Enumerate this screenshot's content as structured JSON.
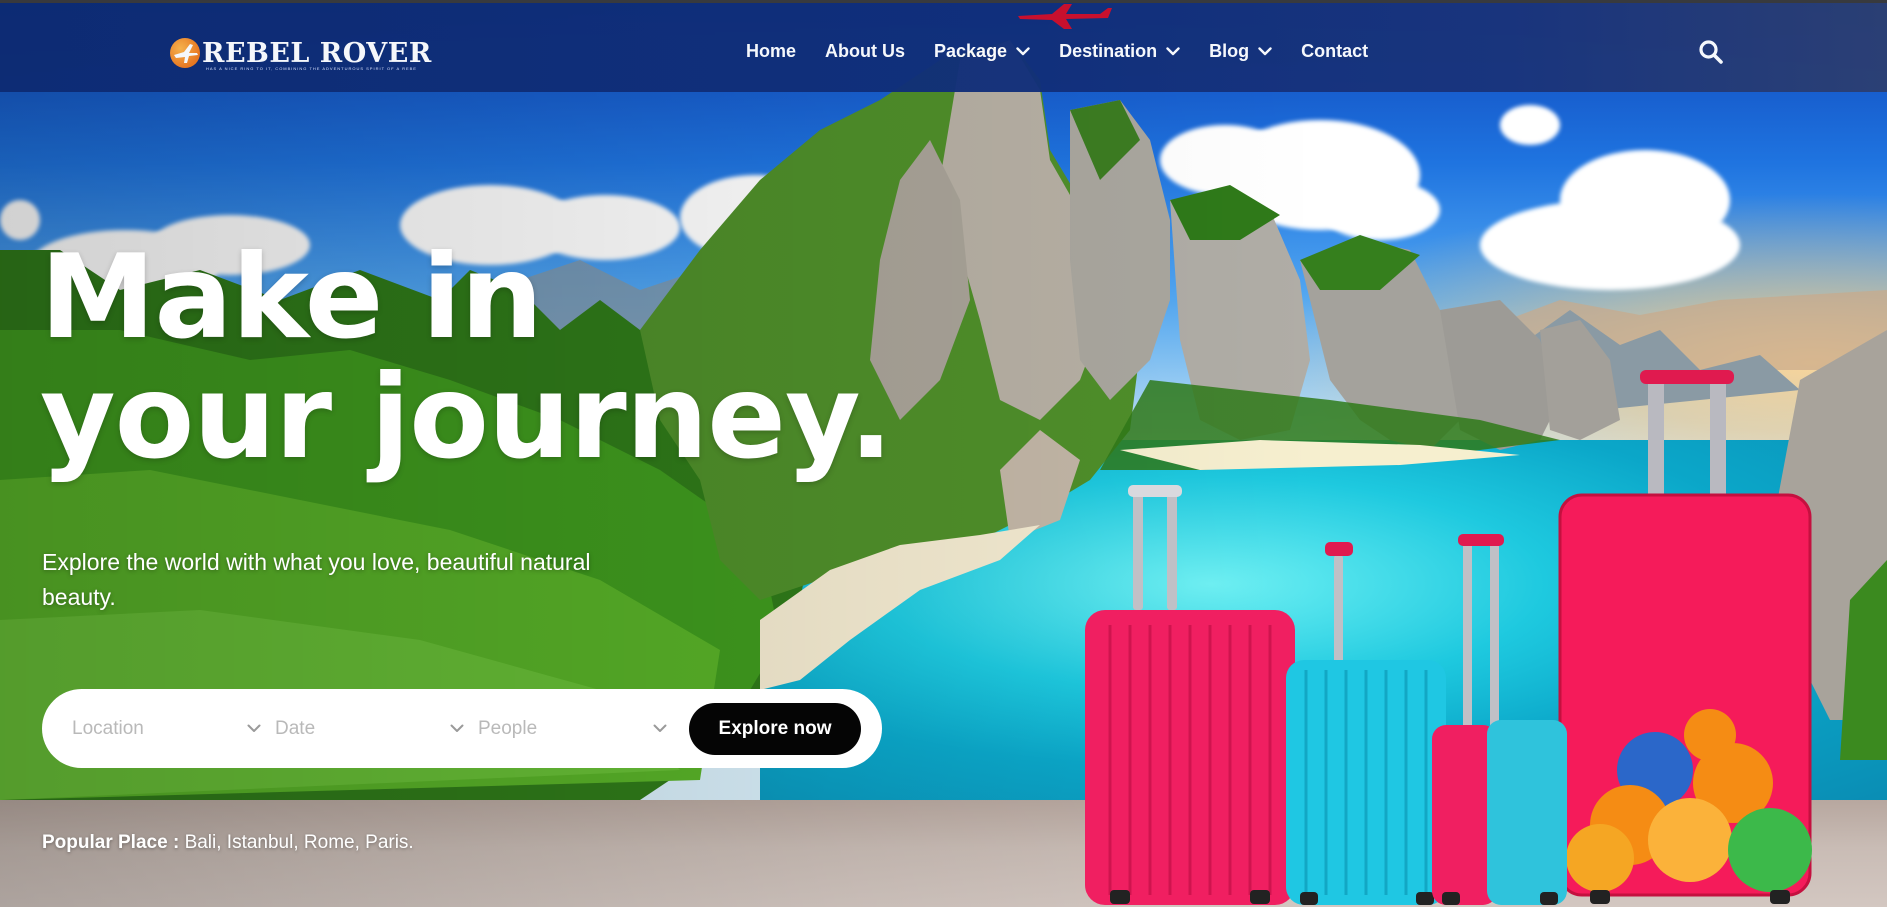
{
  "brand": {
    "name": "REBEL ROVER",
    "tagline": "HAS A NICE RING TO IT, COMBINING THE ADVENTUROUS SPIRIT OF A REBEL"
  },
  "nav": {
    "items": [
      {
        "label": "Home",
        "dropdown": false
      },
      {
        "label": "About Us",
        "dropdown": false
      },
      {
        "label": "Package",
        "dropdown": true
      },
      {
        "label": "Destination",
        "dropdown": true
      },
      {
        "label": "Blog",
        "dropdown": true
      },
      {
        "label": "Contact",
        "dropdown": false
      }
    ],
    "search_icon": "search-icon"
  },
  "hero": {
    "headline_line1": "Make in",
    "headline_line2": "your journey.",
    "subtitle": "Explore the world with what you love, beautiful natural beauty."
  },
  "search": {
    "location_placeholder": "Location",
    "date_placeholder": "Date",
    "people_placeholder": "People",
    "button_label": "Explore now"
  },
  "popular": {
    "label": "Popular Place :",
    "places": "Bali, Istanbul, Rome, Paris."
  },
  "colors": {
    "header": "#112f7a",
    "button": "#050505",
    "accent_orange": "#f07a1d",
    "text": "#ffffff"
  }
}
